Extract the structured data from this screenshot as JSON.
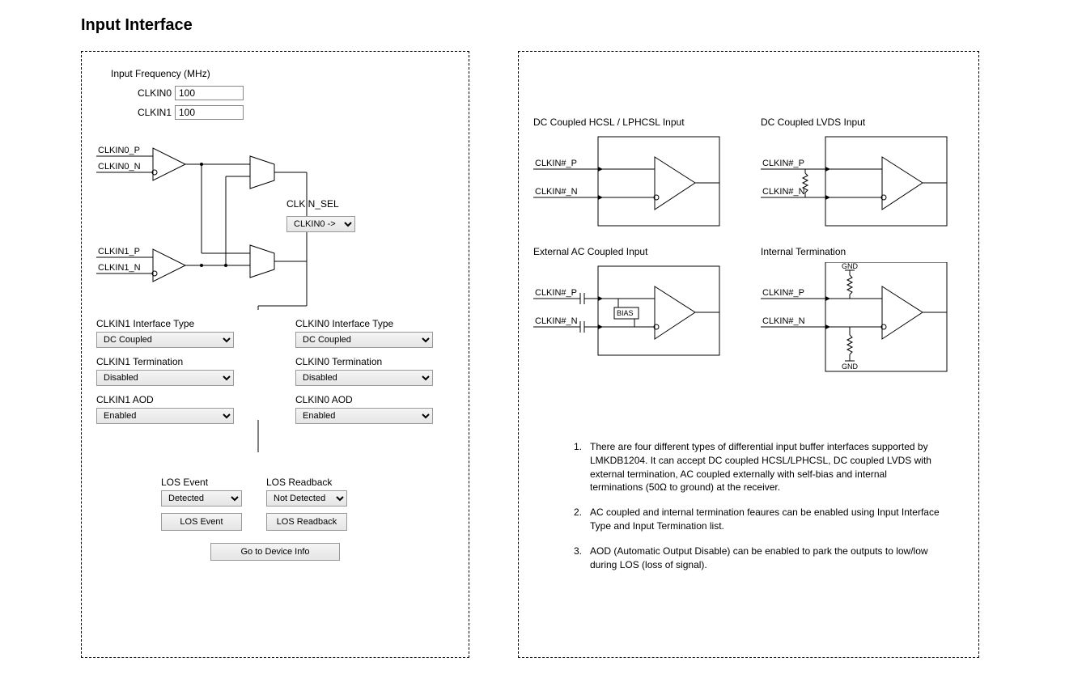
{
  "title": "Input Interface",
  "freq": {
    "header": "Input Frequency (MHz)",
    "clkin0_label": "CLKIN0",
    "clkin0_value": "100",
    "clkin1_label": "CLKIN1",
    "clkin1_value": "100"
  },
  "pins": {
    "clkin0_p": "CLKIN0_P",
    "clkin0_n": "CLKIN0_N",
    "clkin1_p": "CLKIN1_P",
    "clkin1_n": "CLKIN1_N"
  },
  "clkin_sel": {
    "label": "CLKIN_SEL",
    "value": "CLKIN0 ->"
  },
  "controls": {
    "clkin1_if_label": "CLKIN1 Interface Type",
    "clkin1_if_value": "DC Coupled",
    "clkin0_if_label": "CLKIN0 Interface Type",
    "clkin0_if_value": "DC Coupled",
    "clkin1_term_label": "CLKIN1 Termination",
    "clkin1_term_value": "Disabled",
    "clkin0_term_label": "CLKIN0 Termination",
    "clkin0_term_value": "Disabled",
    "clkin1_aod_label": "CLKIN1 AOD",
    "clkin1_aod_value": "Enabled",
    "clkin0_aod_label": "CLKIN0 AOD",
    "clkin0_aod_value": "Enabled"
  },
  "los": {
    "event_label": "LOS Event",
    "event_value": "Detected",
    "event_btn": "LOS Event",
    "readback_label": "LOS Readback",
    "readback_value": "Not Detected",
    "readback_btn": "LOS Readback"
  },
  "go_btn": "Go to Device Info",
  "right_titles": {
    "t1": "DC Coupled HCSL / LPHCSL Input",
    "t2": "DC Coupled LVDS Input",
    "t3": "External AC Coupled Input",
    "t4": "Internal Termination"
  },
  "right_pins": {
    "p": "CLKIN#_P",
    "n": "CLKIN#_N"
  },
  "bias_label": "BIAS",
  "gnd_label": "GND",
  "notes": {
    "n1": "There are four different  types of differential input buffer interfaces supported by LMKDB1204. It can accept DC coupled HCSL/LPHCSL, DC coupled LVDS with external termination, AC coupled externally with self-bias and internal terminations (50Ω to ground) at the receiver.",
    "n2": "AC coupled and internal termination feaures can be enabled using Input Interface Type and Input Termination list.",
    "n3": "AOD (Automatic Output Disable) can be enabled to park the outputs to low/low during LOS (loss of signal)."
  }
}
